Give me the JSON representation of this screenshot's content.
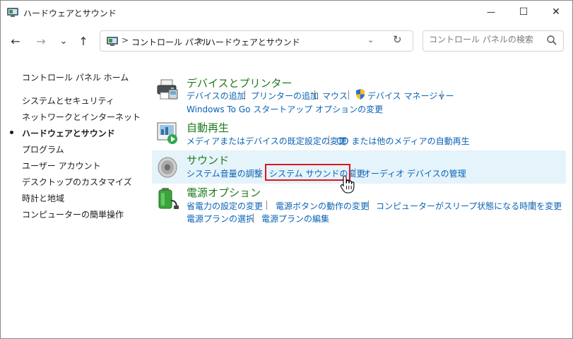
{
  "window": {
    "title": "ハードウェアとサウンド",
    "controls": {
      "minimize": "—",
      "maximize": "☐",
      "close": "✕"
    }
  },
  "navigation": {
    "back": "←",
    "forward": "→",
    "recent": "⌄",
    "up": "↑",
    "breadcrumb": [
      "コントロール パネル",
      "ハードウェアとサウンド"
    ],
    "breadcrumb_separator": ">",
    "search_placeholder": "コントロール パネルの検索"
  },
  "sidebar": {
    "items": [
      {
        "label": "コントロール パネル ホーム",
        "active": false
      },
      {
        "label": "システムとセキュリティ",
        "active": false
      },
      {
        "label": "ネットワークとインターネット",
        "active": false
      },
      {
        "label": "ハードウェアとサウンド",
        "active": true
      },
      {
        "label": "プログラム",
        "active": false
      },
      {
        "label": "ユーザー アカウント",
        "active": false
      },
      {
        "label": "デスクトップのカスタマイズ",
        "active": false
      },
      {
        "label": "時計と地域",
        "active": false
      },
      {
        "label": "コンピューターの簡単操作",
        "active": false
      }
    ]
  },
  "categories": {
    "devices": {
      "title": "デバイスとプリンター",
      "links": [
        "デバイスの追加",
        "プリンターの追加",
        "マウス",
        "デバイス マネージャー",
        "Windows To Go スタートアップ オプションの変更"
      ]
    },
    "autoplay": {
      "title": "自動再生",
      "links": [
        "メディアまたはデバイスの既定設定の変更",
        "CD または他のメディアの自動再生"
      ]
    },
    "sound": {
      "title": "サウンド",
      "links": [
        "システム音量の調整",
        "システム サウンドの変更",
        "オーディオ デバイスの管理"
      ],
      "highlighted_link": "システム サウンドの変更"
    },
    "power": {
      "title": "電源オプション",
      "links": [
        "省電力の設定の変更",
        "電源ボタンの動作の変更",
        "コンピューターがスリープ状態になる時間を変更",
        "電源プランの選択",
        "電源プランの編集"
      ]
    }
  },
  "colors": {
    "category_title": "#1e7a1e",
    "link": "#0a63b5",
    "highlight_bg": "#e5f3fb",
    "annotation_box": "#e0141e"
  }
}
